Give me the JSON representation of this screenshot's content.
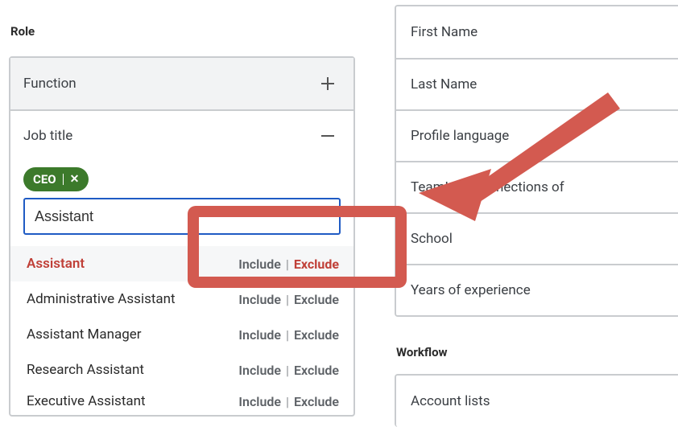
{
  "left": {
    "section_label": "Role",
    "headers": {
      "function": {
        "label": "Function"
      },
      "job_title": {
        "label": "Job title"
      }
    },
    "chip": {
      "label": "CEO"
    },
    "search": {
      "value": "Assistant"
    },
    "suggestions": [
      {
        "label": "Assistant",
        "include": "Include",
        "exclude": "Exclude",
        "highlight": true
      },
      {
        "label": "Administrative Assistant",
        "include": "Include",
        "exclude": "Exclude",
        "highlight": false
      },
      {
        "label": "Assistant Manager",
        "include": "Include",
        "exclude": "Exclude",
        "highlight": false
      },
      {
        "label": "Research Assistant",
        "include": "Include",
        "exclude": "Exclude",
        "highlight": false
      },
      {
        "label": "Executive Assistant",
        "include": "Include",
        "exclude": "Exclude",
        "highlight": false
      }
    ]
  },
  "right": {
    "items1": [
      "First Name",
      "Last Name",
      "Profile language",
      "TeamLink connections of",
      "School",
      "Years of experience"
    ],
    "section_label2": "Workflow",
    "items2": [
      "Account lists"
    ]
  },
  "colors": {
    "accent_red": "#d35a50",
    "chip_green": "#3c7a2b",
    "focus_blue": "#1f5bc4"
  }
}
